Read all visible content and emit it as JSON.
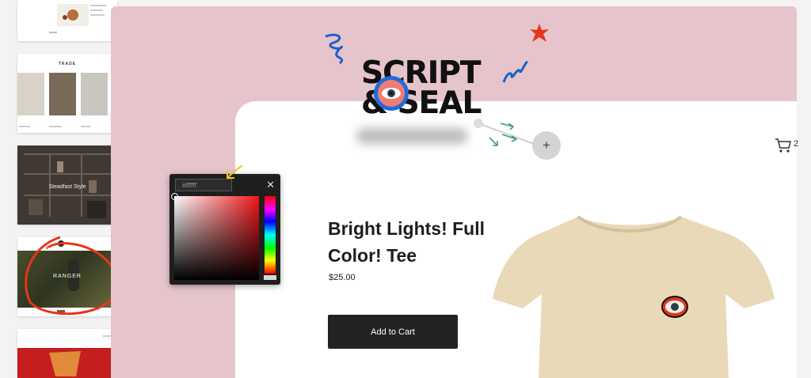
{
  "thumbnails": {
    "t2_title": "TRADE",
    "t3_title": "Steadfast Style",
    "t4_title": "RANGER"
  },
  "logo": {
    "line1": "SCRIPT",
    "line2": "& SEAL"
  },
  "color_picker": {
    "hex_value": "#ffffff",
    "close_label": "✕"
  },
  "product": {
    "title": "Bright Lights! Full Color! Tee",
    "price": "$25.00",
    "add_to_cart": "Add to Cart"
  },
  "header": {
    "cart_count": "2"
  },
  "editor": {
    "add_label": "+"
  },
  "colors": {
    "pink_background": "#e6c4cc",
    "button_dark": "#232323",
    "accent_blue": "#1e6cdc",
    "annotation_red": "#e8341c",
    "shirt_tan": "#e9d9b8"
  }
}
